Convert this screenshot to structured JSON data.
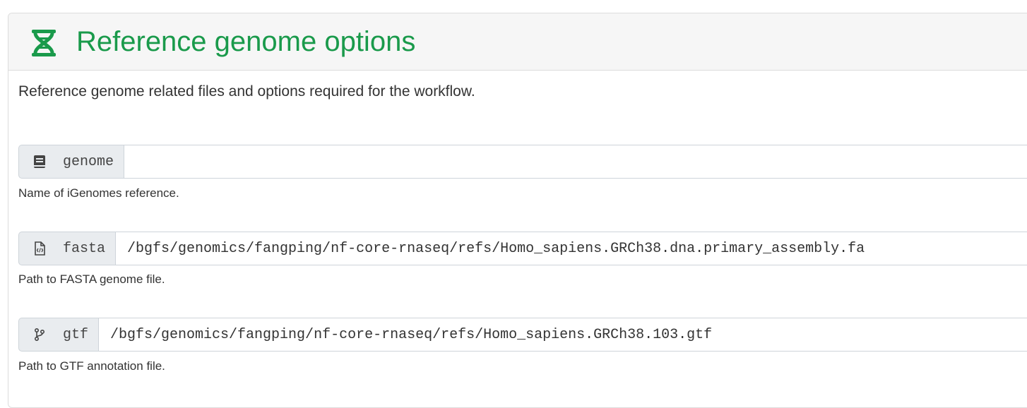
{
  "section": {
    "title": "Reference genome options",
    "description": "Reference genome related files and options required for the workflow.",
    "icon": "dna-icon",
    "accent_color": "#1a9a4b"
  },
  "fields": {
    "genome": {
      "label": "genome",
      "icon": "book-icon",
      "value": "",
      "help": "Name of iGenomes reference."
    },
    "fasta": {
      "label": "fasta",
      "icon": "file-code-icon",
      "value": "/bgfs/genomics/fangping/nf-core-rnaseq/refs/Homo_sapiens.GRCh38.dna.primary_assembly.fa",
      "help": "Path to FASTA genome file."
    },
    "gtf": {
      "label": "gtf",
      "icon": "code-branch-icon",
      "value": "/bgfs/genomics/fangping/nf-core-rnaseq/refs/Homo_sapiens.GRCh38.103.gtf",
      "help": "Path to GTF annotation file."
    }
  }
}
